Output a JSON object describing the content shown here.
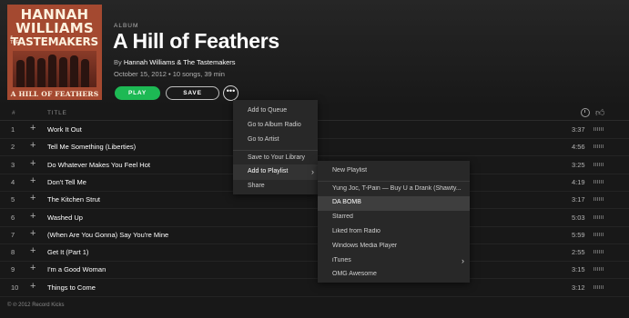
{
  "album": {
    "art": {
      "line1": "HANNAH",
      "line2": "WILLIAMS",
      "the_small": "& THE",
      "line3": "TASTEMAKERS",
      "footer": "A HILL OF FEATHERS"
    },
    "type_label": "ALBUM",
    "title": "A Hill of Feathers",
    "by_prefix": "By ",
    "artist": "Hannah Williams & The Tastemakers",
    "meta": "October 15, 2012 • 10 songs, 39 min",
    "play_label": "PLAY",
    "save_label": "SAVE",
    "more_label": "•••"
  },
  "track_header": {
    "number": "#",
    "title": "TITLE",
    "clock_icon": "clock-icon",
    "thumb_icon": "thumbs-up-icon"
  },
  "tracks": [
    {
      "num": "1",
      "title": "Work It Out",
      "duration": "3:37"
    },
    {
      "num": "2",
      "title": "Tell Me Something (Liberties)",
      "duration": "4:56"
    },
    {
      "num": "3",
      "title": "Do Whatever Makes You Feel Hot",
      "duration": "3:25"
    },
    {
      "num": "4",
      "title": "Don't Tell Me",
      "duration": "4:19"
    },
    {
      "num": "5",
      "title": "The Kitchen Strut",
      "duration": "3:17"
    },
    {
      "num": "6",
      "title": "Washed Up",
      "duration": "5:03"
    },
    {
      "num": "7",
      "title": "(When Are You Gonna) Say You're Mine",
      "duration": "5:59"
    },
    {
      "num": "8",
      "title": "Get It (Part 1)",
      "duration": "2:55"
    },
    {
      "num": "9",
      "title": "I'm a Good Woman",
      "duration": "3:15"
    },
    {
      "num": "10",
      "title": "Things to Come",
      "duration": "3:12"
    }
  ],
  "add_icon": "+",
  "footer": "© ℗ 2012 Record Kicks",
  "context_menu": {
    "items": [
      {
        "label": "Add to Queue"
      },
      {
        "label": "Go to Album Radio"
      },
      {
        "label": "Go to Artist"
      },
      {
        "label": "Save to Your Library"
      },
      {
        "label": "Add to Playlist"
      },
      {
        "label": "Share"
      }
    ],
    "chevron": "›"
  },
  "playlist_menu": {
    "items": [
      {
        "label": "New Playlist"
      },
      {
        "label": "Yung Joc, T-Pain — Buy U a Drank (Shawty..."
      },
      {
        "label": "DA BOMB"
      },
      {
        "label": "Starred"
      },
      {
        "label": "Liked from Radio"
      },
      {
        "label": "Windows Media Player"
      },
      {
        "label": "iTunes"
      },
      {
        "label": "OMG Awesome"
      }
    ],
    "chevron": "›"
  }
}
